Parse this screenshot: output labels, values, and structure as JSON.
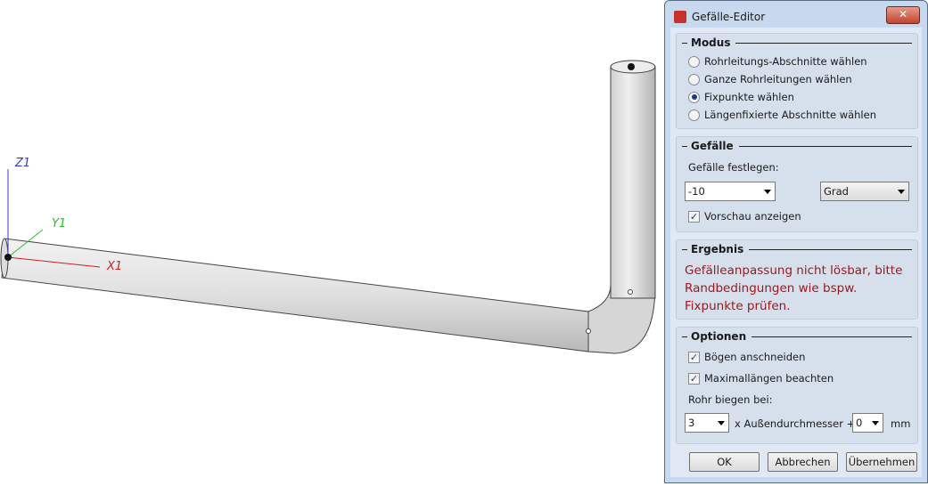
{
  "viewport": {
    "axes": {
      "z": "Z1",
      "y": "Y1",
      "x": "X1"
    }
  },
  "dialog": {
    "title": "Gefälle-Editor",
    "close_label": "✕",
    "modus": {
      "label": "Modus",
      "options": [
        "Rohrleitungs-Abschnitte wählen",
        "Ganze Rohrleitungen wählen",
        "Fixpunkte wählen",
        "Längenfixierte Abschnitte wählen"
      ],
      "selected": 2
    },
    "gefaelle": {
      "label": "Gefälle",
      "field_label": "Gefälle festlegen:",
      "value": "-10",
      "unit": "Grad",
      "preview_label": "Vorschau anzeigen",
      "preview_checked": true
    },
    "ergebnis": {
      "label": "Ergebnis",
      "message": "Gefälleanpassung nicht lösbar, bitte Randbedingungen wie bspw. Fixpunkte prüfen."
    },
    "optionen": {
      "label": "Optionen",
      "cut_bends": "Bögen anschneiden",
      "max_lengths": "Maximallängen beachten",
      "bend_label": "Rohr biegen bei:",
      "factor": "3",
      "factor_suffix": "x Außendurchmesser +",
      "offset": "0",
      "offset_unit": "mm"
    },
    "buttons": {
      "ok": "OK",
      "cancel": "Abbrechen",
      "apply": "Übernehmen"
    }
  }
}
